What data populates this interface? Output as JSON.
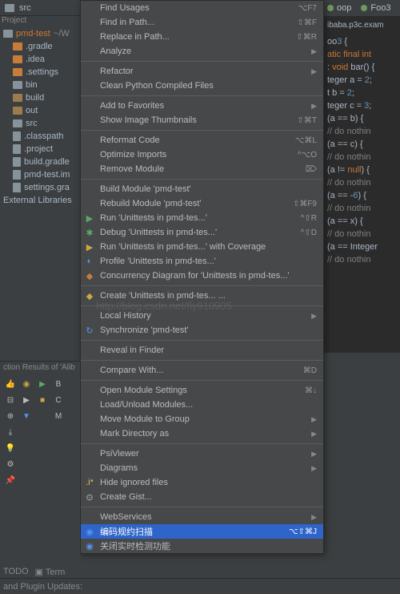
{
  "topbar": {
    "src_label": "src",
    "oop_label": "oop",
    "foo_label": "Foo3"
  },
  "project": {
    "label": "Project",
    "root": "pmd-test",
    "root_path": "~/W",
    "items": [
      {
        "label": ".gradle",
        "kind": "orange"
      },
      {
        "label": ".idea",
        "kind": "orange"
      },
      {
        "label": ".settings",
        "kind": "orange"
      },
      {
        "label": "bin",
        "kind": "gray"
      },
      {
        "label": "build",
        "kind": "build"
      },
      {
        "label": "out",
        "kind": "build"
      },
      {
        "label": "src",
        "kind": "gray"
      },
      {
        "label": ".classpath",
        "kind": "file"
      },
      {
        "label": ".project",
        "kind": "file"
      },
      {
        "label": "build.gradle",
        "kind": "file"
      },
      {
        "label": "pmd-test.im",
        "kind": "file"
      },
      {
        "label": "settings.gra",
        "kind": "file"
      }
    ],
    "external": "External Libraries"
  },
  "menu": [
    {
      "label": "Find Usages",
      "shortcut": "⌥F7"
    },
    {
      "label": "Find in Path...",
      "shortcut": "⇧⌘F"
    },
    {
      "label": "Replace in Path...",
      "shortcut": "⇧⌘R"
    },
    {
      "label": "Analyze",
      "arrow": true
    },
    {
      "sep": true
    },
    {
      "label": "Refactor",
      "arrow": true
    },
    {
      "label": "Clean Python Compiled Files"
    },
    {
      "sep": true
    },
    {
      "label": "Add to Favorites",
      "arrow": true
    },
    {
      "label": "Show Image Thumbnails",
      "shortcut": "⇧⌘T"
    },
    {
      "sep": true
    },
    {
      "label": "Reformat Code",
      "shortcut": "⌥⌘L"
    },
    {
      "label": "Optimize Imports",
      "shortcut": "^⌥O"
    },
    {
      "label": "Remove Module",
      "shortcut": "⌦"
    },
    {
      "sep": true
    },
    {
      "label": "Build Module 'pmd-test'"
    },
    {
      "label": "Rebuild Module 'pmd-test'",
      "shortcut": "⇧⌘F9"
    },
    {
      "label": "Run 'Unittests in pmd-tes...'",
      "shortcut": "^⇧R",
      "icon": "run"
    },
    {
      "label": "Debug 'Unittests in pmd-tes...'",
      "shortcut": "^⇧D",
      "icon": "debug"
    },
    {
      "label": "Run 'Unittests in pmd-tes...' with Coverage",
      "icon": "coverage"
    },
    {
      "label": "Profile 'Unittests in pmd-tes...'",
      "icon": "profile"
    },
    {
      "label": "Concurrency Diagram for 'Unittests in pmd-tes...'",
      "icon": "diagram"
    },
    {
      "sep": true
    },
    {
      "label": "Create 'Unittests in pmd-tes... ...",
      "icon": "create"
    },
    {
      "sep": true
    },
    {
      "label": "Local History",
      "arrow": true
    },
    {
      "label": "Synchronize 'pmd-test'",
      "icon": "sync"
    },
    {
      "sep": true
    },
    {
      "label": "Reveal in Finder"
    },
    {
      "sep": true
    },
    {
      "label": "Compare With...",
      "shortcut": "⌘D"
    },
    {
      "sep": true
    },
    {
      "label": "Open Module Settings",
      "shortcut": "⌘↓"
    },
    {
      "label": "Load/Unload Modules..."
    },
    {
      "label": "Move Module to Group",
      "arrow": true
    },
    {
      "label": "Mark Directory as",
      "arrow": true
    },
    {
      "sep": true
    },
    {
      "label": "PsiViewer",
      "arrow": true
    },
    {
      "label": "Diagrams",
      "arrow": true
    },
    {
      "label": "Hide ignored files",
      "icon": "hide"
    },
    {
      "label": "Create Gist...",
      "icon": "gist"
    },
    {
      "sep": true
    },
    {
      "label": "WebServices",
      "arrow": true
    },
    {
      "label": "编码规约扫描",
      "shortcut": "⌥⇧⌘J",
      "icon": "ali",
      "selected": true
    },
    {
      "label": "关闭实时检测功能",
      "icon": "ali"
    }
  ],
  "editor": {
    "tab": "ibaba.p3c.exam",
    "lines": [
      "oo3 {",
      "atic final int",
      ": void bar() {",
      "teger a = 2;",
      "t b = 2;",
      "teger c = 3;",
      "",
      "(a == b) {",
      "  // do nothin",
      "",
      "(a == c) {",
      "  // do nothin",
      "",
      "(a != null) {",
      "  // do nothin",
      "",
      "(a == -6) {",
      "  // do nothin",
      "",
      "(a == x) {",
      "  // do nothin",
      "",
      "(a == Integer",
      "  // do nothin"
    ]
  },
  "bottom": {
    "label": "ction Results of 'Alib",
    "item1": "B",
    "item2": "C",
    "item3": "M"
  },
  "status": {
    "todo": "TODO",
    "term": "Term",
    "plugin": "and Plugin Updates:"
  },
  "watermark": "http://blog.csdn.net/fly910905"
}
